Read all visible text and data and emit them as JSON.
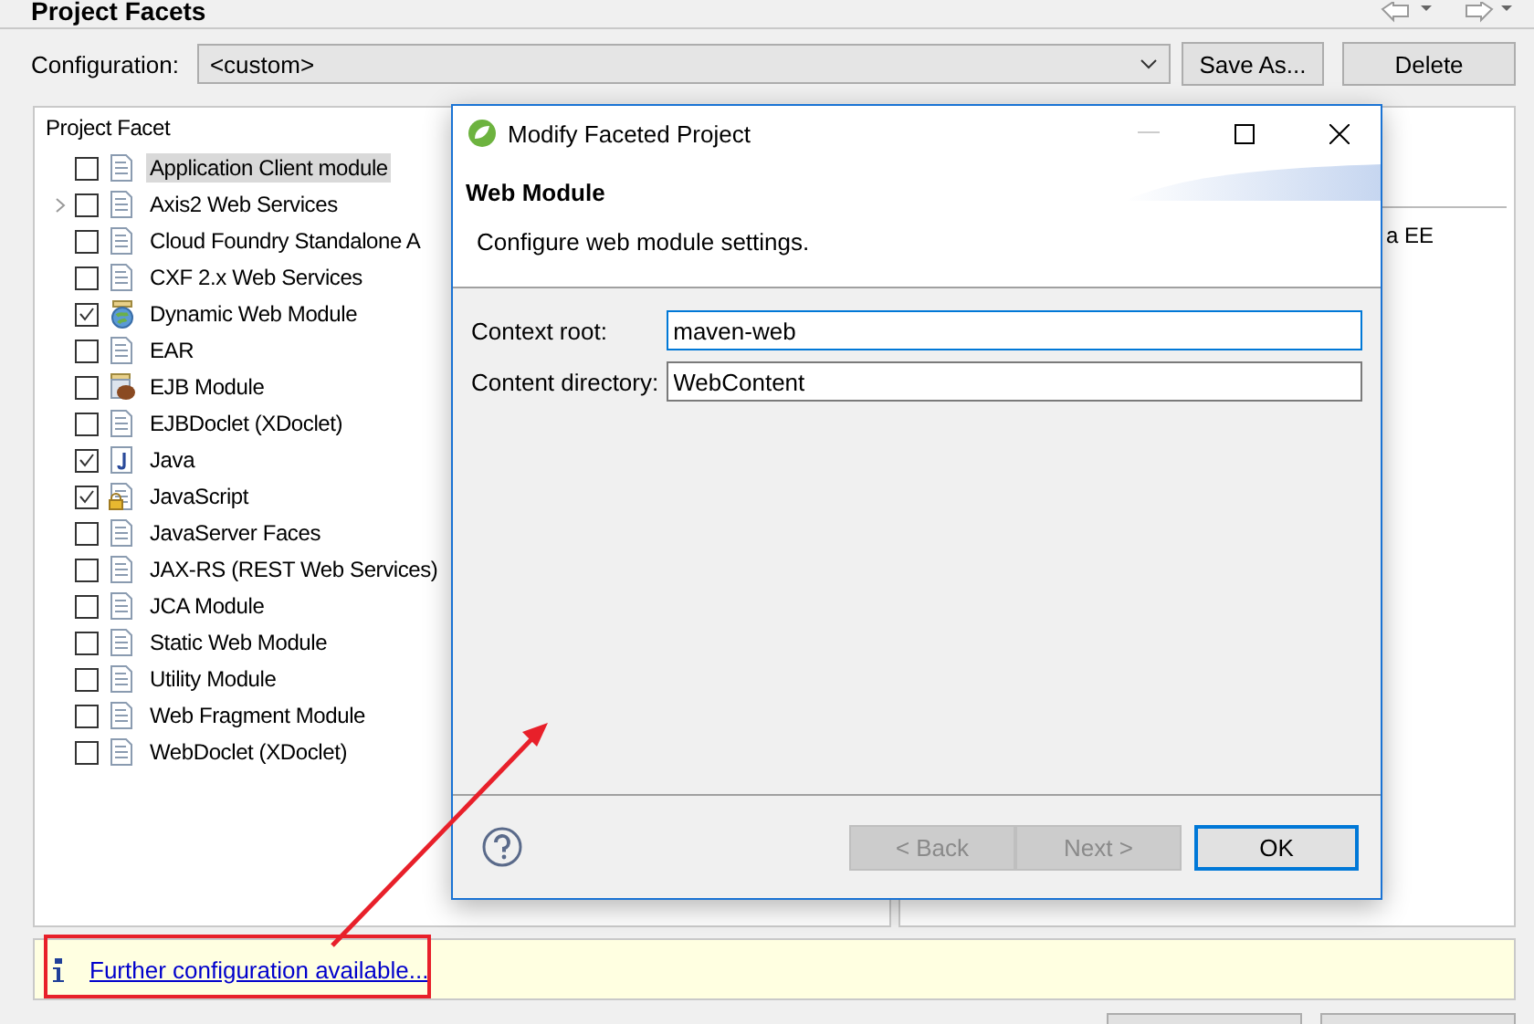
{
  "page": {
    "title": "Project Facets"
  },
  "configuration": {
    "label": "Configuration:",
    "value": "<custom>",
    "buttons": [
      "Save As...",
      "Delete"
    ]
  },
  "facets_panel": {
    "header": "Project Facet",
    "facets": [
      {
        "label": "Application Client module",
        "checked": false,
        "selected": true,
        "kind": "document",
        "expandable": false
      },
      {
        "label": "Axis2 Web Services",
        "checked": false,
        "selected": false,
        "kind": "document",
        "expandable": true
      },
      {
        "label": "Cloud Foundry Standalone A",
        "checked": false,
        "selected": false,
        "kind": "document",
        "expandable": false
      },
      {
        "label": "CXF 2.x Web Services",
        "checked": false,
        "selected": false,
        "kind": "document",
        "expandable": false
      },
      {
        "label": "Dynamic Web Module",
        "checked": true,
        "selected": false,
        "kind": "web",
        "expandable": false
      },
      {
        "label": "EAR",
        "checked": false,
        "selected": false,
        "kind": "document",
        "expandable": false
      },
      {
        "label": "EJB Module",
        "checked": false,
        "selected": false,
        "kind": "bean",
        "expandable": false
      },
      {
        "label": "EJBDoclet (XDoclet)",
        "checked": false,
        "selected": false,
        "kind": "document",
        "expandable": false
      },
      {
        "label": "Java",
        "checked": true,
        "selected": false,
        "kind": "java",
        "expandable": false
      },
      {
        "label": "JavaScript",
        "checked": true,
        "selected": false,
        "kind": "locked",
        "expandable": false
      },
      {
        "label": "JavaServer Faces",
        "checked": false,
        "selected": false,
        "kind": "document",
        "expandable": false
      },
      {
        "label": "JAX-RS (REST Web Services)",
        "checked": false,
        "selected": false,
        "kind": "document",
        "expandable": false
      },
      {
        "label": "JCA Module",
        "checked": false,
        "selected": false,
        "kind": "document",
        "expandable": false
      },
      {
        "label": "Static Web Module",
        "checked": false,
        "selected": false,
        "kind": "document",
        "expandable": false
      },
      {
        "label": "Utility Module",
        "checked": false,
        "selected": false,
        "kind": "document",
        "expandable": false
      },
      {
        "label": "Web Fragment Module",
        "checked": false,
        "selected": false,
        "kind": "document",
        "expandable": false
      },
      {
        "label": "WebDoclet (XDoclet)",
        "checked": false,
        "selected": false,
        "kind": "document",
        "expandable": false
      }
    ]
  },
  "details_panel": {
    "text": "a EE"
  },
  "info_bar": {
    "link": "Further configuration available..."
  },
  "dialog": {
    "title": "Modify Faceted Project",
    "heading": "Web Module",
    "description": "Configure web module settings.",
    "fields": [
      {
        "label": "Context root:",
        "value": "maven-web",
        "focused": true
      },
      {
        "label": "Content directory:",
        "value": "WebContent",
        "focused": false
      }
    ],
    "buttons": [
      {
        "label": "< Back",
        "disabled": true,
        "default": false
      },
      {
        "label": "Next >",
        "disabled": true,
        "default": false
      },
      {
        "label": "OK",
        "disabled": false,
        "default": true
      }
    ]
  }
}
